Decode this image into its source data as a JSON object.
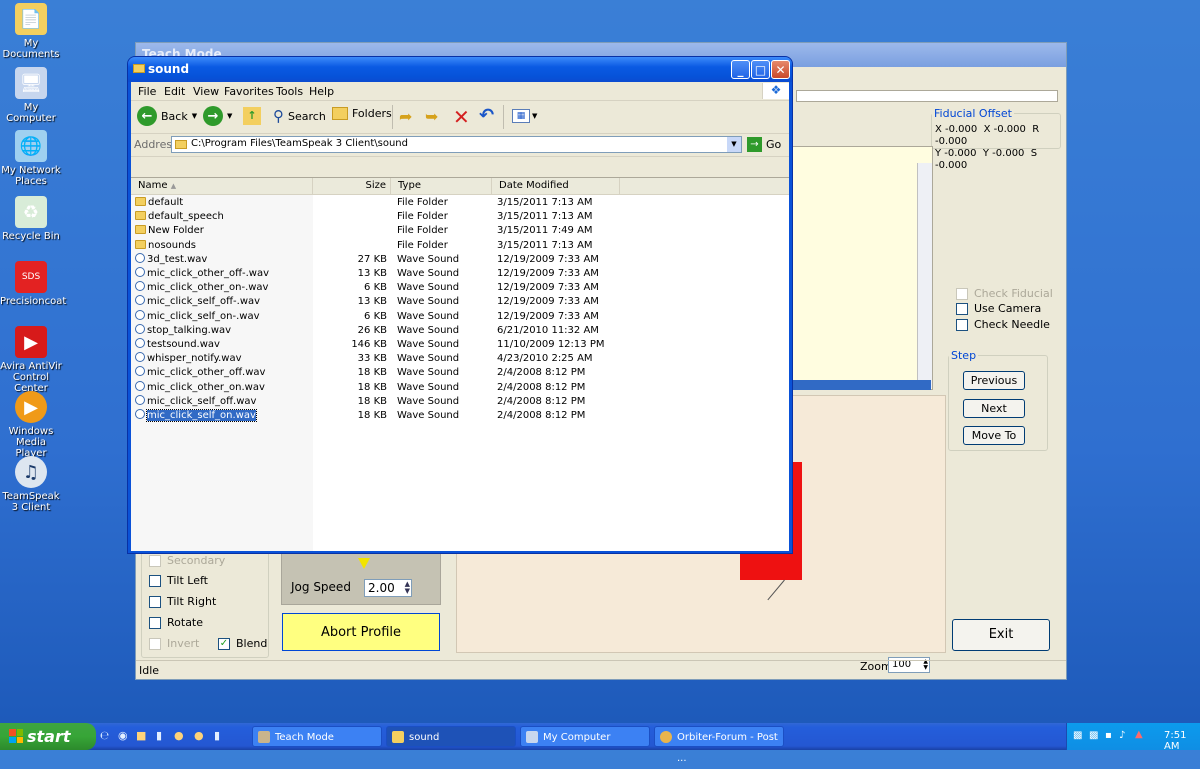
{
  "desktop": {
    "icons": [
      {
        "label": "My Documents"
      },
      {
        "label": "My Computer"
      },
      {
        "label": "My Network Places"
      },
      {
        "label": "Recycle Bin"
      },
      {
        "label": "Precisioncoat"
      },
      {
        "label": "Avira AntiVir Control Center"
      },
      {
        "label": "Windows Media Player"
      },
      {
        "label": "TeamSpeak 3 Client"
      }
    ]
  },
  "teach": {
    "title": "Teach Mode",
    "fiducial": {
      "legend": "Fiducial Offset",
      "x": "X -0.000",
      "y": "Y -0.000",
      "x2": "X -0.000",
      "y2": "Y -0.000",
      "r": "R -0.000",
      "s": "S -0.000"
    },
    "checks": {
      "check_fiducial": "Check Fiducial",
      "use_camera": "Use Camera",
      "check_needle": "Check Needle"
    },
    "step": {
      "legend": "Step",
      "previous": "Previous",
      "next": "Next",
      "move_to": "Move To"
    },
    "left_checks": {
      "secondary": "Secondary",
      "tilt_left": "Tilt Left",
      "tilt_right": "Tilt Right",
      "rotate": "Rotate",
      "invert": "Invert",
      "blend": "Blend"
    },
    "jog_speed_label": "Jog Speed",
    "jog_speed_value": "2.00",
    "abort_profile": "Abort Profile",
    "exit": "Exit",
    "zoom_label": "Zoom",
    "zoom_value": "100",
    "status": "Idle"
  },
  "explorer": {
    "title": "sound",
    "menu": [
      "File",
      "Edit",
      "View",
      "Favorites",
      "Tools",
      "Help"
    ],
    "toolbar": {
      "back": "Back",
      "search": "Search",
      "folders": "Folders"
    },
    "address_label": "Address",
    "address_value": "C:\\Program Files\\TeamSpeak 3 Client\\sound",
    "go": "Go",
    "columns": {
      "name": "Name",
      "size": "Size",
      "type": "Type",
      "modified": "Date Modified"
    },
    "files": [
      {
        "name": "default",
        "size": "",
        "type": "File Folder",
        "modified": "3/15/2011 7:13 AM",
        "kind": "folder"
      },
      {
        "name": "default_speech",
        "size": "",
        "type": "File Folder",
        "modified": "3/15/2011 7:13 AM",
        "kind": "folder"
      },
      {
        "name": "New Folder",
        "size": "",
        "type": "File Folder",
        "modified": "3/15/2011 7:49 AM",
        "kind": "folder"
      },
      {
        "name": "nosounds",
        "size": "",
        "type": "File Folder",
        "modified": "3/15/2011 7:13 AM",
        "kind": "folder"
      },
      {
        "name": "3d_test.wav",
        "size": "27 KB",
        "type": "Wave Sound",
        "modified": "12/19/2009 7:33 AM",
        "kind": "wav"
      },
      {
        "name": "mic_click_other_off-.wav",
        "size": "13 KB",
        "type": "Wave Sound",
        "modified": "12/19/2009 7:33 AM",
        "kind": "wav"
      },
      {
        "name": "mic_click_other_on-.wav",
        "size": "6 KB",
        "type": "Wave Sound",
        "modified": "12/19/2009 7:33 AM",
        "kind": "wav"
      },
      {
        "name": "mic_click_self_off-.wav",
        "size": "13 KB",
        "type": "Wave Sound",
        "modified": "12/19/2009 7:33 AM",
        "kind": "wav"
      },
      {
        "name": "mic_click_self_on-.wav",
        "size": "6 KB",
        "type": "Wave Sound",
        "modified": "12/19/2009 7:33 AM",
        "kind": "wav"
      },
      {
        "name": "stop_talking.wav",
        "size": "26 KB",
        "type": "Wave Sound",
        "modified": "6/21/2010 11:32 AM",
        "kind": "wav"
      },
      {
        "name": "testsound.wav",
        "size": "146 KB",
        "type": "Wave Sound",
        "modified": "11/10/2009 12:13 PM",
        "kind": "wav"
      },
      {
        "name": "whisper_notify.wav",
        "size": "33 KB",
        "type": "Wave Sound",
        "modified": "4/23/2010 2:25 AM",
        "kind": "wav"
      },
      {
        "name": "mic_click_other_off.wav",
        "size": "18 KB",
        "type": "Wave Sound",
        "modified": "2/4/2008 8:12 PM",
        "kind": "wav"
      },
      {
        "name": "mic_click_other_on.wav",
        "size": "18 KB",
        "type": "Wave Sound",
        "modified": "2/4/2008 8:12 PM",
        "kind": "wav"
      },
      {
        "name": "mic_click_self_off.wav",
        "size": "18 KB",
        "type": "Wave Sound",
        "modified": "2/4/2008 8:12 PM",
        "kind": "wav"
      },
      {
        "name": "mic_click_self_on.wav",
        "size": "18 KB",
        "type": "Wave Sound",
        "modified": "2/4/2008 8:12 PM",
        "kind": "wav",
        "selected": true
      }
    ]
  },
  "taskbar": {
    "start": "start",
    "tasks": [
      {
        "label": "Teach Mode"
      },
      {
        "label": "sound",
        "active": true
      },
      {
        "label": "My Computer"
      },
      {
        "label": "Orbiter-Forum - Post ..."
      }
    ],
    "clock": "7:51 AM"
  },
  "colors": {
    "xp_blue": "#0a52d8",
    "abort_yellow": "#ffff80",
    "selection": "#316ac5",
    "desktop": "#2f6fd0"
  }
}
